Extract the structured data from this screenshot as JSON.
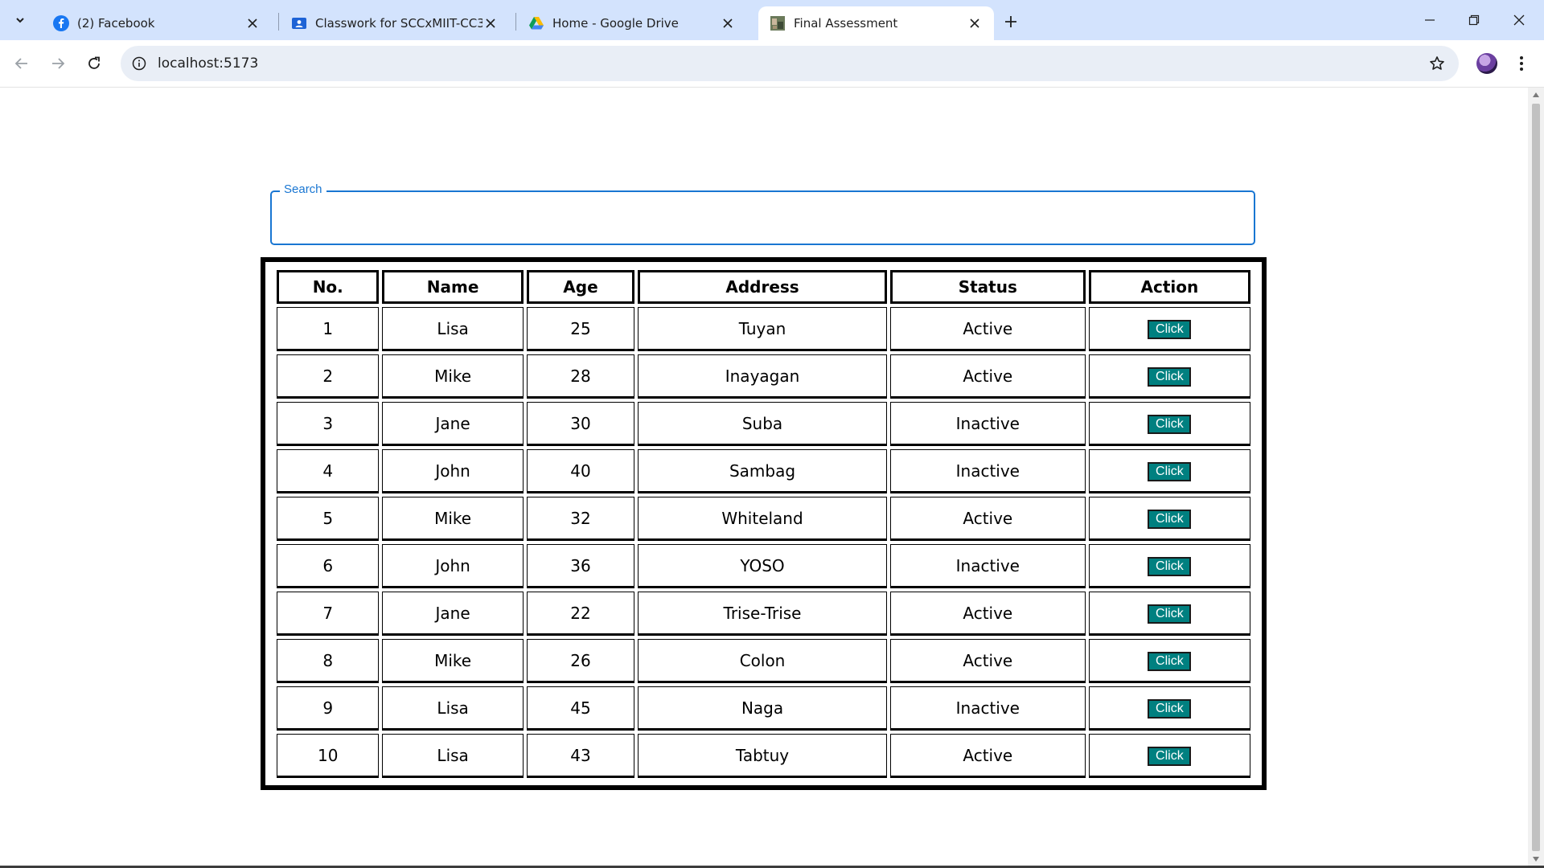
{
  "browser": {
    "tabs": [
      {
        "title": "(2) Facebook",
        "icon": "facebook-icon",
        "active": false
      },
      {
        "title": "Classwork for SCCxMIIT-CC313",
        "icon": "classroom-icon",
        "active": false
      },
      {
        "title": "Home - Google Drive",
        "icon": "google-drive-icon",
        "active": false
      },
      {
        "title": "Final Assessment",
        "icon": "page-favicon",
        "active": true
      }
    ],
    "url": "localhost:5173"
  },
  "search": {
    "label": "Search",
    "value": ""
  },
  "table": {
    "headers": [
      "No.",
      "Name",
      "Age",
      "Address",
      "Status",
      "Action"
    ],
    "rows": [
      {
        "no": "1",
        "name": "Lisa",
        "age": "25",
        "address": "Tuyan",
        "status": "Active",
        "action": "Click"
      },
      {
        "no": "2",
        "name": "Mike",
        "age": "28",
        "address": "Inayagan",
        "status": "Active",
        "action": "Click"
      },
      {
        "no": "3",
        "name": "Jane",
        "age": "30",
        "address": "Suba",
        "status": "Inactive",
        "action": "Click"
      },
      {
        "no": "4",
        "name": "John",
        "age": "40",
        "address": "Sambag",
        "status": "Inactive",
        "action": "Click"
      },
      {
        "no": "5",
        "name": "Mike",
        "age": "32",
        "address": "Whiteland",
        "status": "Active",
        "action": "Click"
      },
      {
        "no": "6",
        "name": "John",
        "age": "36",
        "address": "YOSO",
        "status": "Inactive",
        "action": "Click"
      },
      {
        "no": "7",
        "name": "Jane",
        "age": "22",
        "address": "Trise-Trise",
        "status": "Active",
        "action": "Click"
      },
      {
        "no": "8",
        "name": "Mike",
        "age": "26",
        "address": "Colon",
        "status": "Active",
        "action": "Click"
      },
      {
        "no": "9",
        "name": "Lisa",
        "age": "45",
        "address": "Naga",
        "status": "Inactive",
        "action": "Click"
      },
      {
        "no": "10",
        "name": "Lisa",
        "age": "43",
        "address": "Tabtuy",
        "status": "Active",
        "action": "Click"
      }
    ]
  },
  "colors": {
    "accent": "#1976d2",
    "button_bg": "#008080",
    "tabstrip_bg": "#d3e3fd"
  }
}
